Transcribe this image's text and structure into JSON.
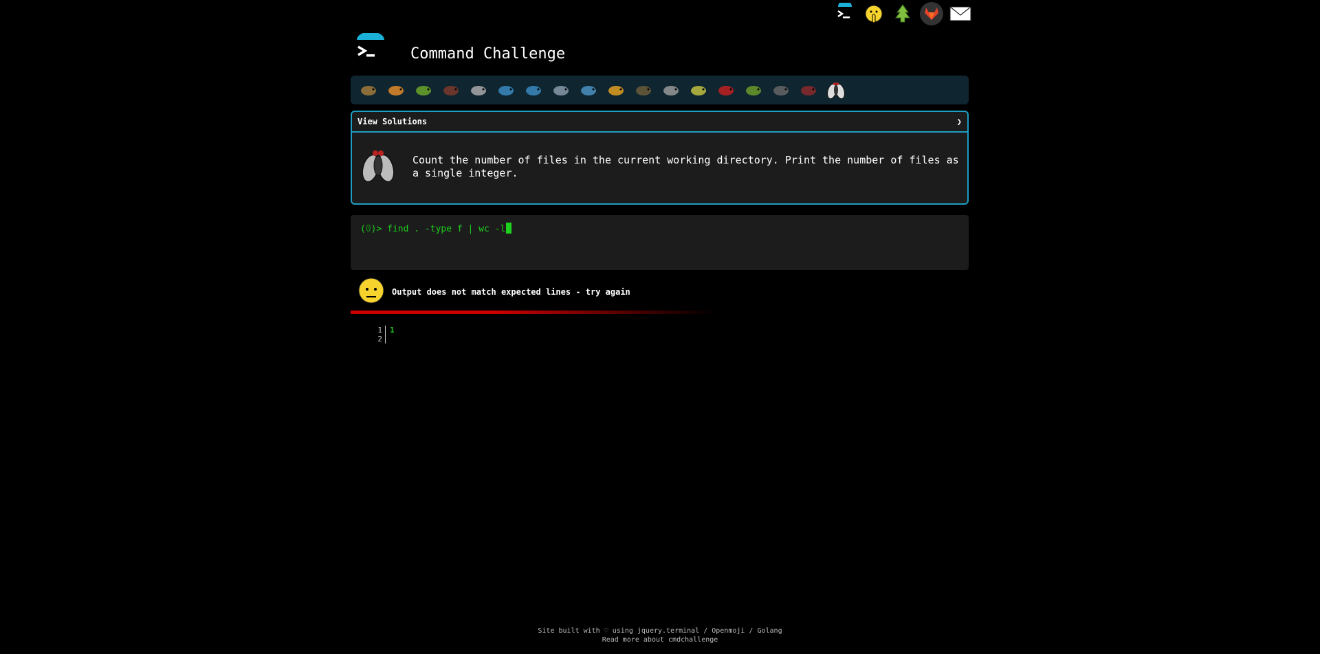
{
  "app": {
    "title": "Command Challenge"
  },
  "top_icons": [
    "terminal-icon",
    "shushing-face-icon",
    "tree-icon",
    "gitlab-fox-icon",
    "envelope-icon"
  ],
  "challenges": [
    "snail-icon",
    "butterfly-icon",
    "caterpillar-icon",
    "ant-icon",
    "spider-web-icon",
    "whale-icon",
    "dolphin-icon",
    "shark-icon",
    "fish-icon",
    "tropical-fish-icon",
    "pufferfish-icon",
    "wolf-icon",
    "bee-icon",
    "ladybug-icon",
    "worm-icon",
    "mosquito-icon",
    "scorpion-icon",
    "fly-icon"
  ],
  "task": {
    "view_solutions_label": "View Solutions",
    "toggle_glyph": "❯",
    "description": "Count the number of files in the current working directory. Print the number of files as a single integer."
  },
  "terminal": {
    "prompt_open": "(",
    "prompt_count": "0",
    "prompt_close": ")>",
    "command": "find . -type f | wc -l"
  },
  "result": {
    "message": "Output does not match expected lines - try again"
  },
  "output": {
    "lines": [
      {
        "no": "1",
        "value": "1"
      },
      {
        "no": "2",
        "value": ""
      }
    ]
  },
  "footer": {
    "line1": "Site built with ♡ using jquery.terminal / Openmoji / Golang",
    "line2": "Read more about cmdchallenge"
  },
  "colors": {
    "accent": "#1d9fc4",
    "terminal_green": "#1dd01d",
    "error_red": "#cc0000"
  }
}
